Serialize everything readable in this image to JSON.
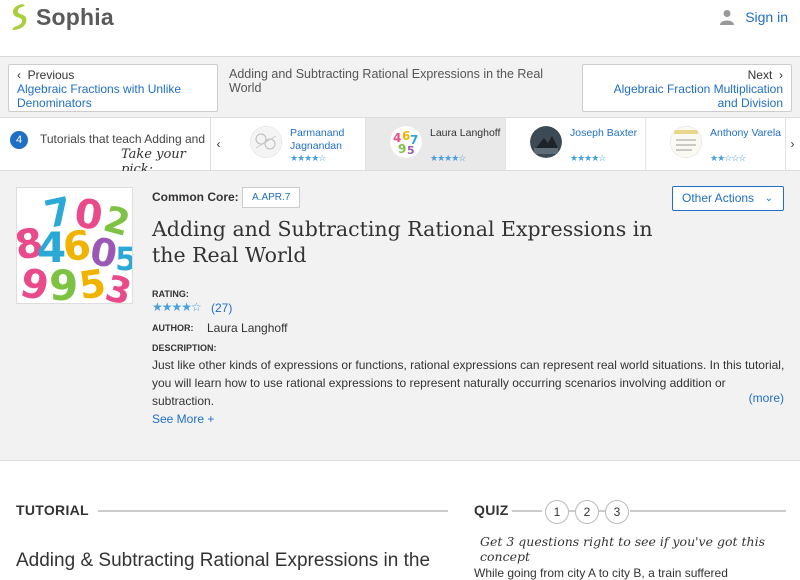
{
  "header": {
    "brand": "Sophia",
    "signin_label": "Sign in",
    "colors": {
      "brand_green": "#a7cf3c",
      "link_blue": "#1f6fc4"
    }
  },
  "nav": {
    "prev_dir": "Previous",
    "prev_title": "Algebraic Fractions with Unlike Denominators",
    "center_title": "Adding and Subtracting Rational Expressions in the Real World",
    "next_dir": "Next",
    "next_title": "Algebraic Fraction Multiplication and Division"
  },
  "tutorials": {
    "count": "4",
    "intro": "Tutorials that teach Adding and",
    "pick": "Take your pick:",
    "items": [
      {
        "name": "Parmanand Jagnandan",
        "stars": "★★★★☆",
        "active": false
      },
      {
        "name": "Laura Langhoff",
        "stars": "★★★★☆",
        "active": true
      },
      {
        "name": "Joseph Baxter",
        "stars": "★★★★☆",
        "active": false
      },
      {
        "name": "Anthony Varela",
        "stars": "★★☆☆☆",
        "active": false
      }
    ]
  },
  "detail": {
    "common_core_label": "Common Core:",
    "common_core_code": "A.APR.7",
    "other_actions": "Other Actions",
    "title": "Adding and Subtracting Rational Expressions in the Real World",
    "rating_label": "RATING:",
    "rating_stars": "★★★★☆",
    "rating_count": "(27)",
    "author_label": "AUTHOR:",
    "author": "Laura Langhoff",
    "description_label": "DESCRIPTION:",
    "description": "Just like other kinds of expressions or functions, rational expressions can represent real world situations. In this tutorial, you will learn how to use rational expressions to represent naturally occurring scenarios involving addition or subtraction.",
    "more": "(more)",
    "see_more": "See More +"
  },
  "tutorial_section": {
    "label": "TUTORIAL",
    "heading": "Adding & Subtracting Rational Expressions in the"
  },
  "quiz": {
    "label": "QUIZ",
    "questions": [
      "1",
      "2",
      "3"
    ],
    "prompt": "Get 3 questions right to see if you've got this concept",
    "question_text": "While going from city A to city B, a train suffered"
  }
}
